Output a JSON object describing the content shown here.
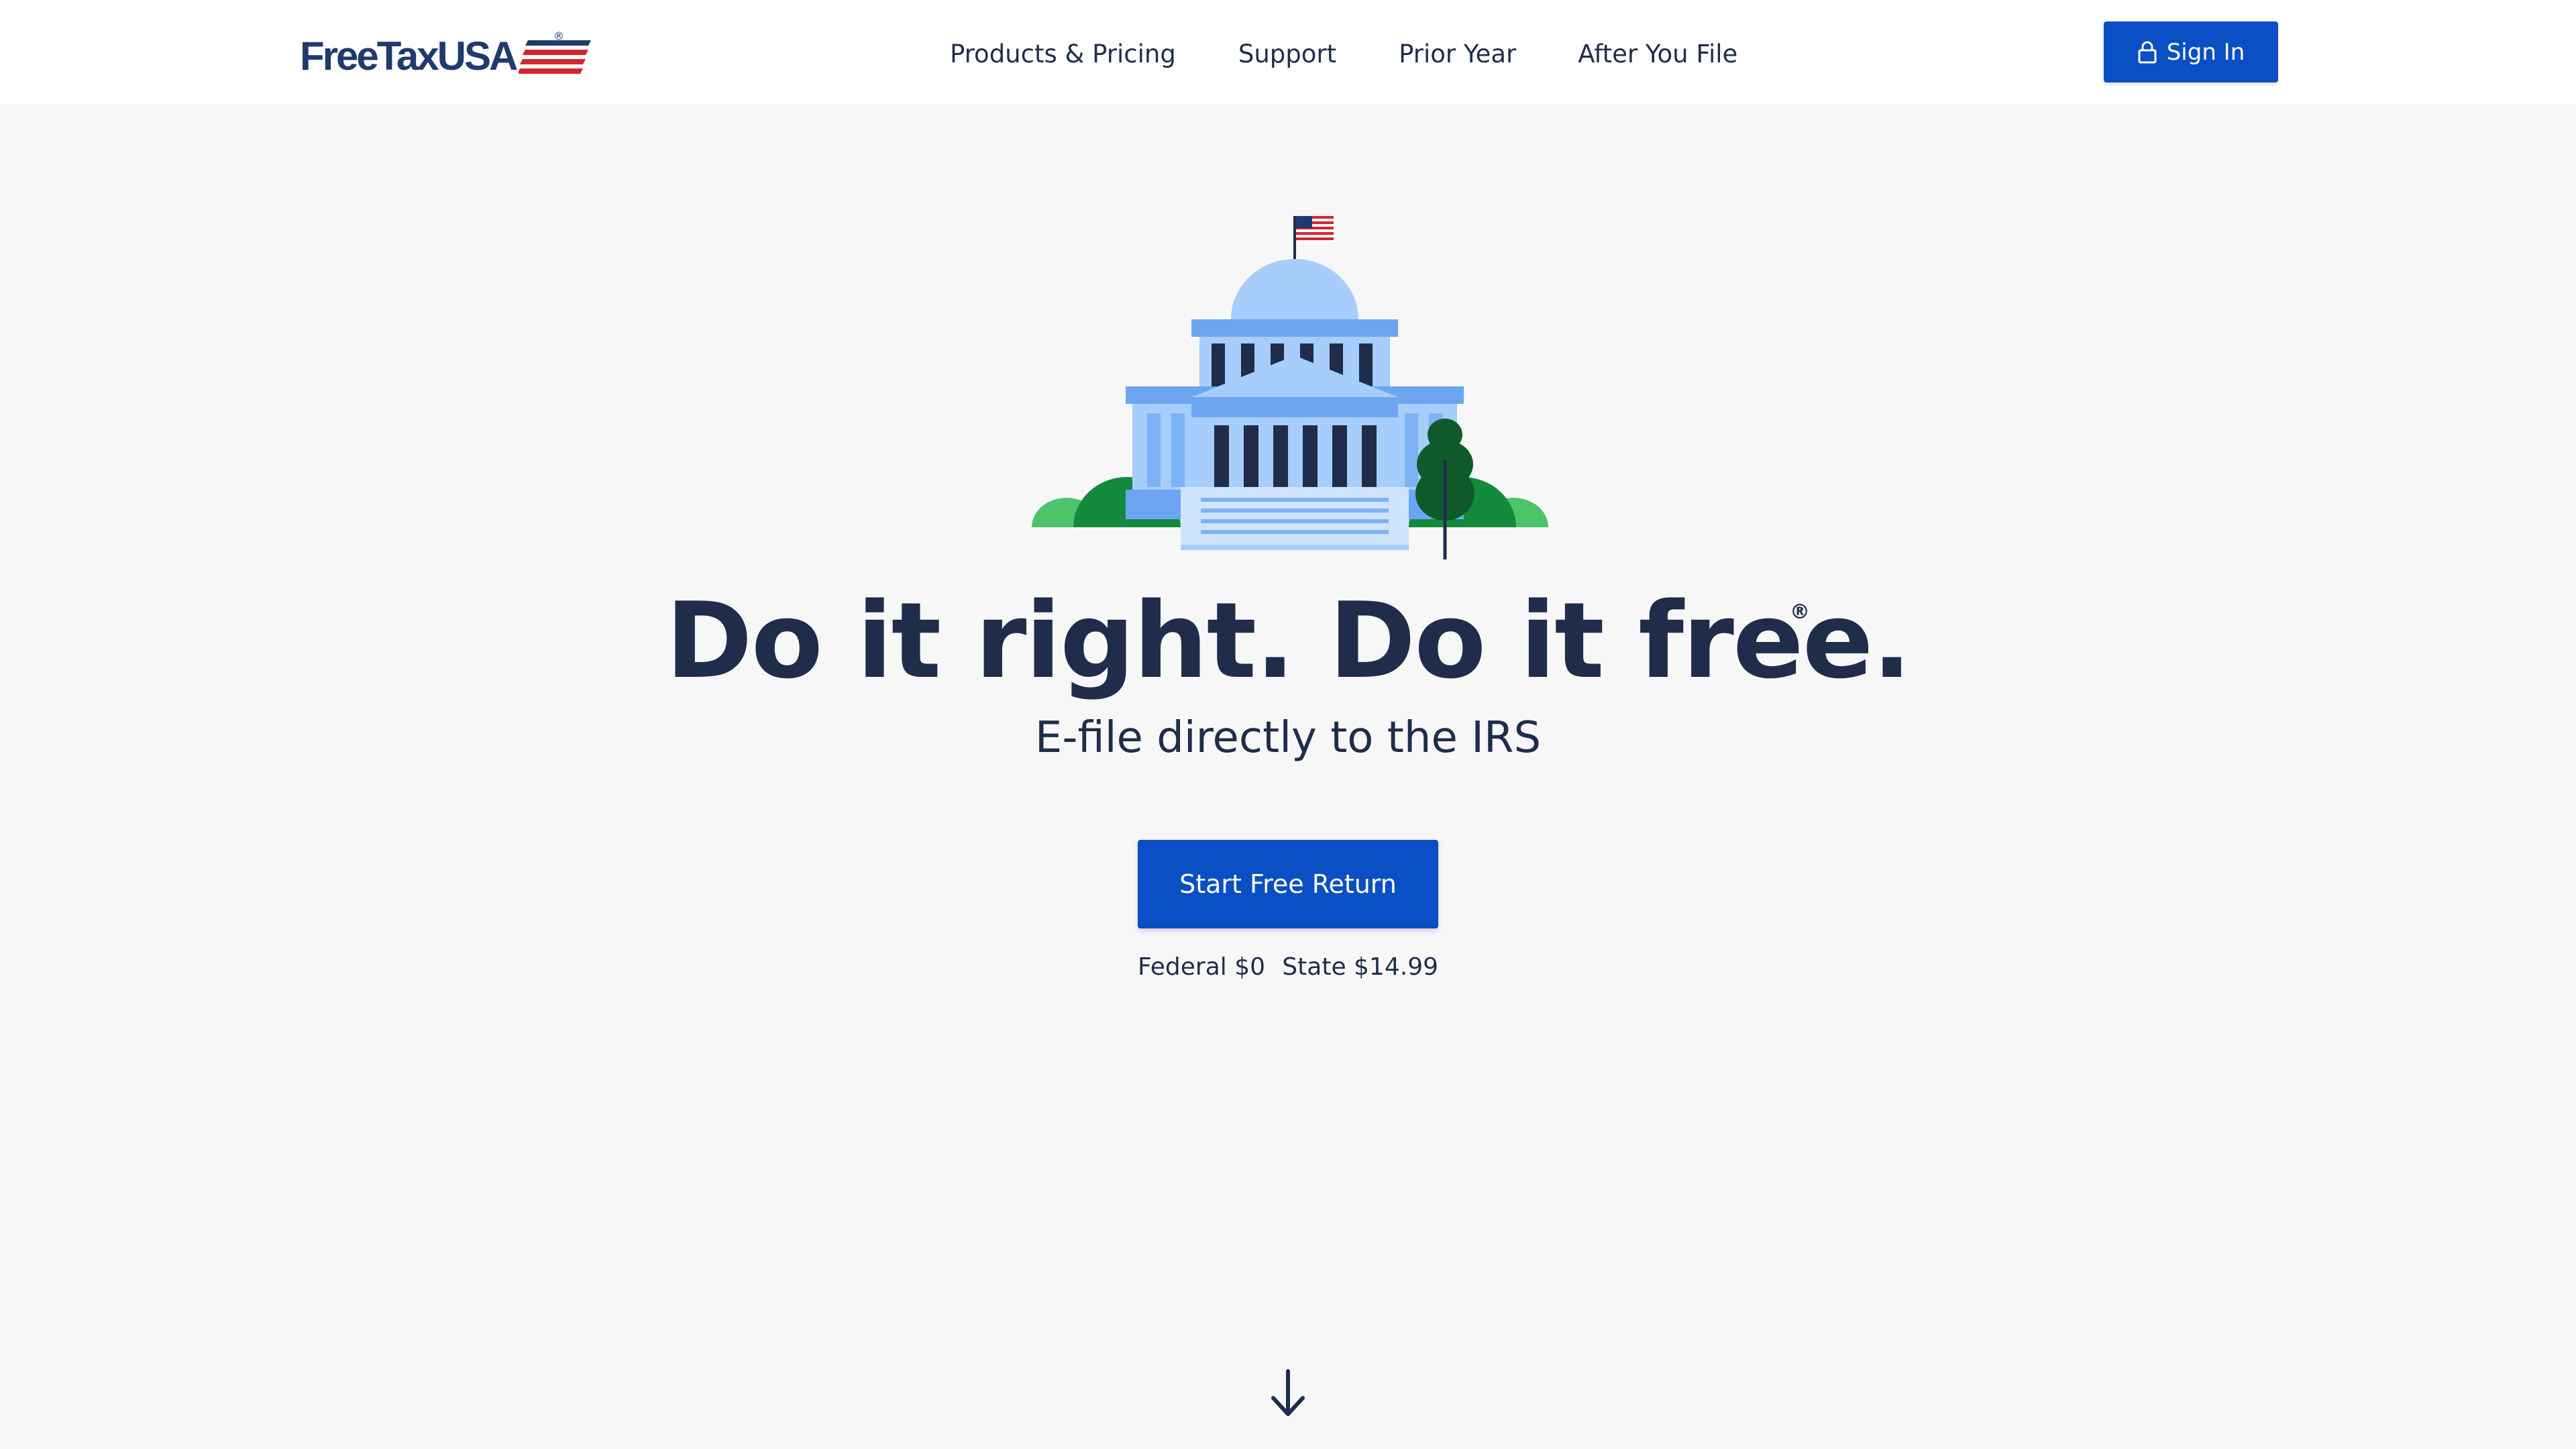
{
  "brand": {
    "name": "FreeTaxUSA",
    "registered": "®",
    "colors": {
      "navy": "#1f3a6e",
      "red": "#d22630",
      "blue": "#0b4fc4"
    }
  },
  "nav": {
    "items": [
      {
        "label": "Products & Pricing"
      },
      {
        "label": "Support"
      },
      {
        "label": "Prior Year"
      },
      {
        "label": "After You File"
      }
    ]
  },
  "signin": {
    "label": "Sign In",
    "icon": "lock-icon"
  },
  "hero": {
    "illustration": "capitol-building",
    "headline": "Do it right. Do it free.",
    "headline_mark": "®",
    "subhead": "E-file directly to the IRS",
    "cta_label": "Start Free Return",
    "federal_price": "Federal $0",
    "state_price": "State $14.99"
  },
  "scroll": {
    "icon": "arrow-down-icon"
  }
}
